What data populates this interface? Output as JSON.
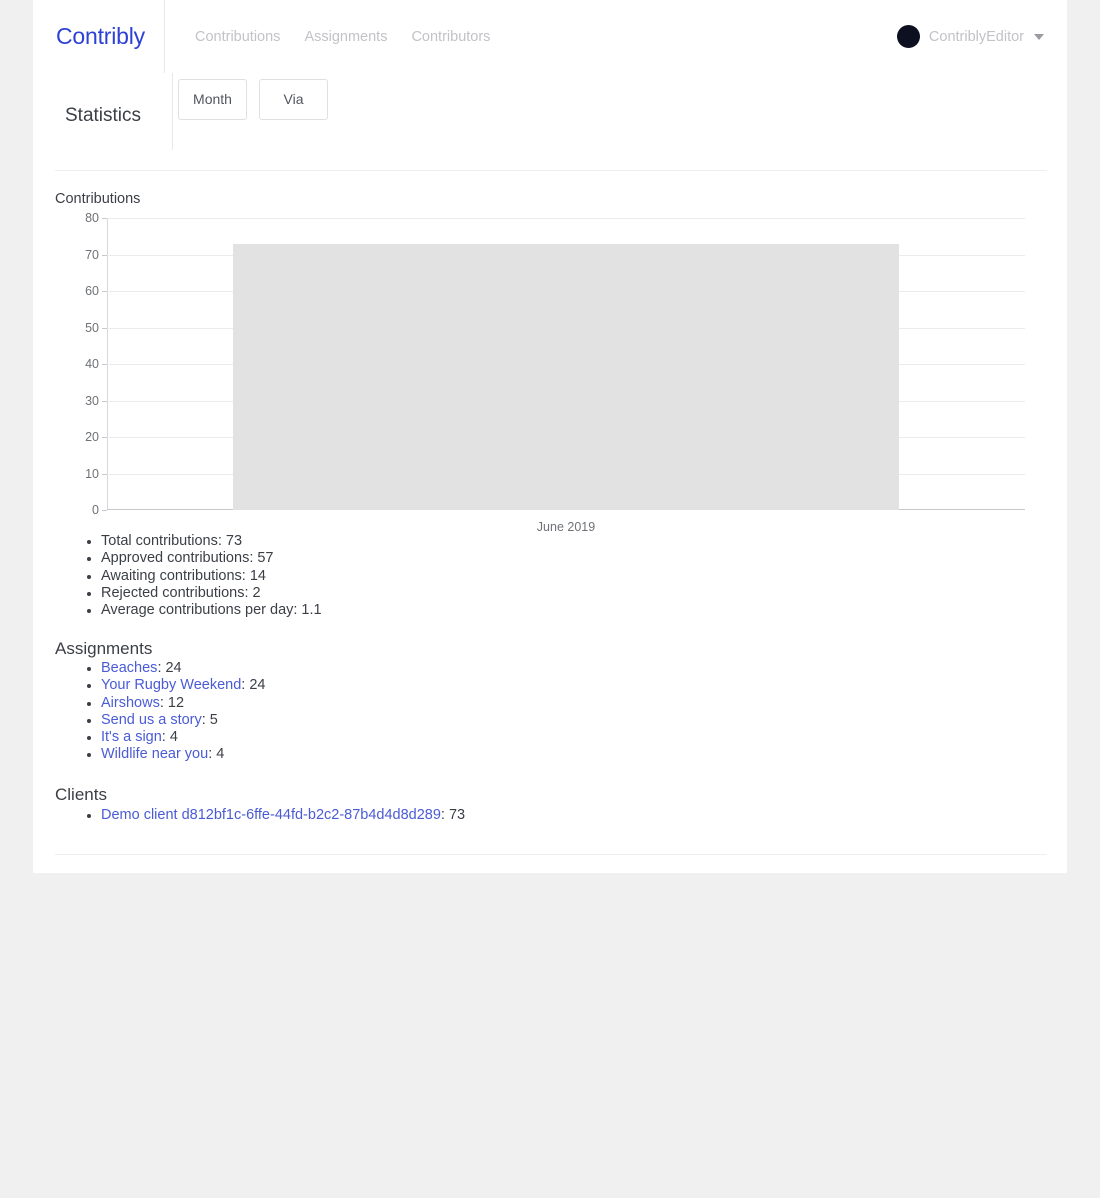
{
  "navbar": {
    "brand": "Contribly",
    "links": [
      {
        "label": "Contributions"
      },
      {
        "label": "Assignments"
      },
      {
        "label": "Contributors"
      }
    ],
    "user": {
      "name": "ContriblyEditor",
      "avatar_icon": "avatar-circle",
      "caret_icon": "chevron-down-icon",
      "avatar_color": "#0d1020"
    }
  },
  "subheader": {
    "title": "Statistics",
    "filters": [
      {
        "label": "Month"
      },
      {
        "label": "Via"
      }
    ]
  },
  "chart_data": {
    "type": "bar",
    "title": "Contributions",
    "categories": [
      "June 2019"
    ],
    "values": [
      73
    ],
    "xlabel": "",
    "ylabel": "",
    "ylim": [
      0,
      80
    ],
    "yticks": [
      80,
      70,
      60,
      50,
      40,
      30,
      20,
      10,
      0
    ],
    "grid": true,
    "legend": false,
    "bar_color": "#e2e2e3"
  },
  "stats": {
    "items": [
      {
        "label": "Total contributions",
        "value": "73",
        "text": "Total contributions: 73"
      },
      {
        "label": "Approved contributions",
        "value": "57",
        "text": "Approved contributions: 57"
      },
      {
        "label": "Awaiting contributions",
        "value": "14",
        "text": "Awaiting contributions: 14"
      },
      {
        "label": "Rejected contributions",
        "value": "2",
        "text": "Rejected contributions: 2"
      },
      {
        "label": "Average contributions per day",
        "value": "1.1",
        "text": "Average contributions per day: 1.1"
      }
    ]
  },
  "assignments": {
    "heading": "Assignments",
    "items": [
      {
        "name": "Beaches",
        "count": ": 24"
      },
      {
        "name": "Your Rugby Weekend",
        "count": ": 24"
      },
      {
        "name": "Airshows",
        "count": ": 12"
      },
      {
        "name": "Send us a story",
        "count": ": 5"
      },
      {
        "name": "It's a sign",
        "count": ": 4"
      },
      {
        "name": "Wildlife near you",
        "count": ": 4"
      }
    ]
  },
  "clients": {
    "heading": "Clients",
    "items": [
      {
        "name": "Demo client d812bf1c-6ffe-44fd-b2c2-87b4d4d8d289",
        "count": ": 73"
      }
    ]
  },
  "theme": {
    "brand_color": "#2d41d8",
    "link_color": "#4a5bd6",
    "text_color": "#3b3f45",
    "muted_color": "#c2c2c8",
    "page_background": "#f0f0f0"
  }
}
